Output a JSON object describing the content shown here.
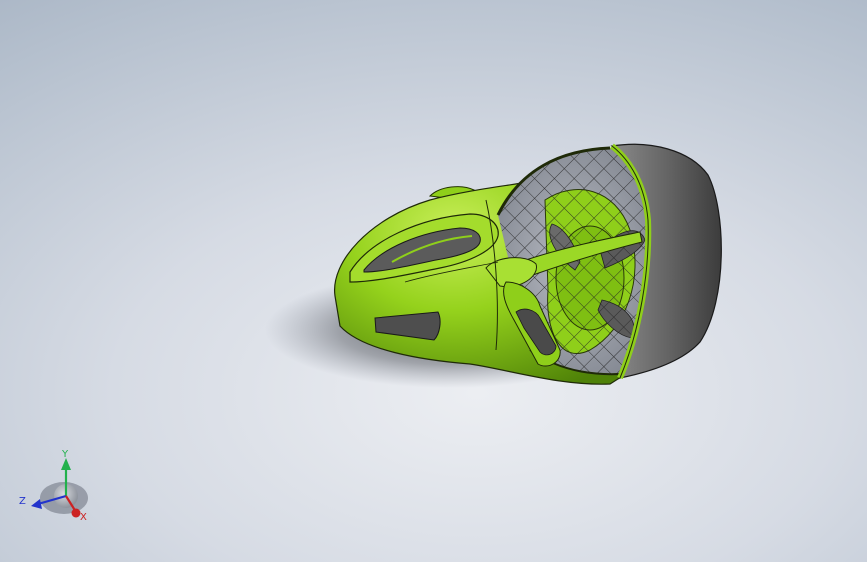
{
  "viewport": {
    "background_top": "#98a6b8",
    "background_bottom": "#eceef2"
  },
  "model": {
    "body_color": "#8fcf1a",
    "body_shade": "#5e9410",
    "shroud_color": "#6a6a6a",
    "mesh_color": "#2a2a2a",
    "window_color": "#5a5a5a"
  },
  "triad": {
    "y_label": "Y",
    "z_label": "Z",
    "x_label": "X",
    "y_color": "#22b14c",
    "z_color": "#2233cc",
    "x_color": "#cc2222"
  }
}
